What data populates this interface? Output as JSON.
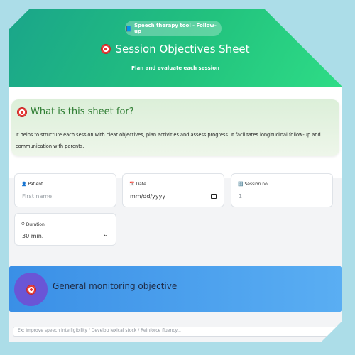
{
  "header": {
    "badge": "Speech therapy tool - Follow-up",
    "title": "Session Objectives Sheet",
    "subtitle": "Plan and evaluate each session"
  },
  "info": {
    "title": "What is this sheet for?",
    "text": "It helps to structure each session with clear objectives, plan activities and assess progress. It facilitates longitudinal follow-up and communication with parents."
  },
  "form": {
    "patient": {
      "label": "Patient",
      "placeholder": "First name"
    },
    "date": {
      "label": "Date",
      "value": "mm/dd/yyyy"
    },
    "session": {
      "label": "Session no.",
      "placeholder": "1"
    },
    "duration": {
      "label": "Duration",
      "value": "30 min."
    }
  },
  "section": {
    "title": "General monitoring objective",
    "placeholder": "Ex: Improve speech intelligibility / Develop lexical stock / Reinforce fluency..."
  }
}
